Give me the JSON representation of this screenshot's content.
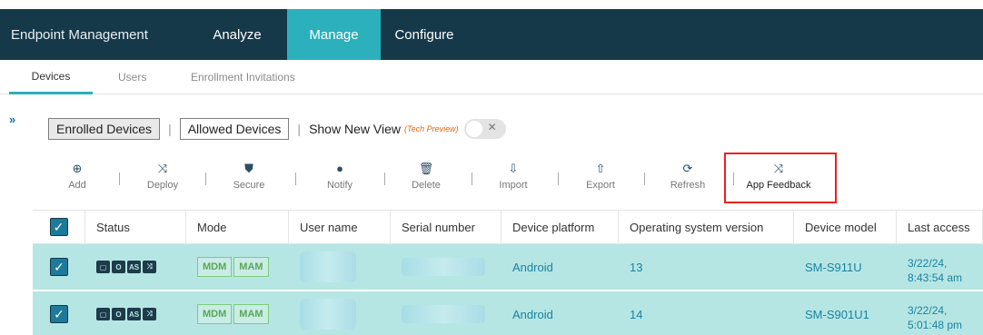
{
  "topnav": {
    "brand": "Endpoint Management",
    "items": [
      "Analyze",
      "Manage",
      "Configure"
    ]
  },
  "subtabs": [
    "Devices",
    "Users",
    "Enrollment Invitations"
  ],
  "expander": "»",
  "viewbar": {
    "enrolled": "Enrolled Devices",
    "allowed": "Allowed Devices",
    "show_new_view": "Show New View",
    "tech_preview": "(Tech Preview)"
  },
  "toolbar": {
    "add": "Add",
    "deploy": "Deploy",
    "secure": "Secure",
    "notify": "Notify",
    "delete": "Delete",
    "import": "Import",
    "export": "Export",
    "refresh": "Refresh",
    "app_feedback": "App Feedback"
  },
  "table": {
    "headers": [
      "Status",
      "Mode",
      "User name",
      "Serial number",
      "Device platform",
      "Operating system version",
      "Device model",
      "Last access"
    ],
    "rows": [
      {
        "modes": [
          "MDM",
          "MAM"
        ],
        "platform": "Android",
        "os": "13",
        "model": "SM-S911U",
        "access_date": "3/22/24,",
        "access_time": "8:43:54 am"
      },
      {
        "modes": [
          "MDM",
          "MAM"
        ],
        "platform": "Android",
        "os": "14",
        "model": "SM-S901U1",
        "access_date": "3/22/24,",
        "access_time": "5:01:48 pm"
      }
    ]
  },
  "colors": {
    "nav_bg": "#16394a",
    "accent": "#2bb0bc",
    "row_selected": "#b6e6e4",
    "highlight": "#e8231f"
  }
}
